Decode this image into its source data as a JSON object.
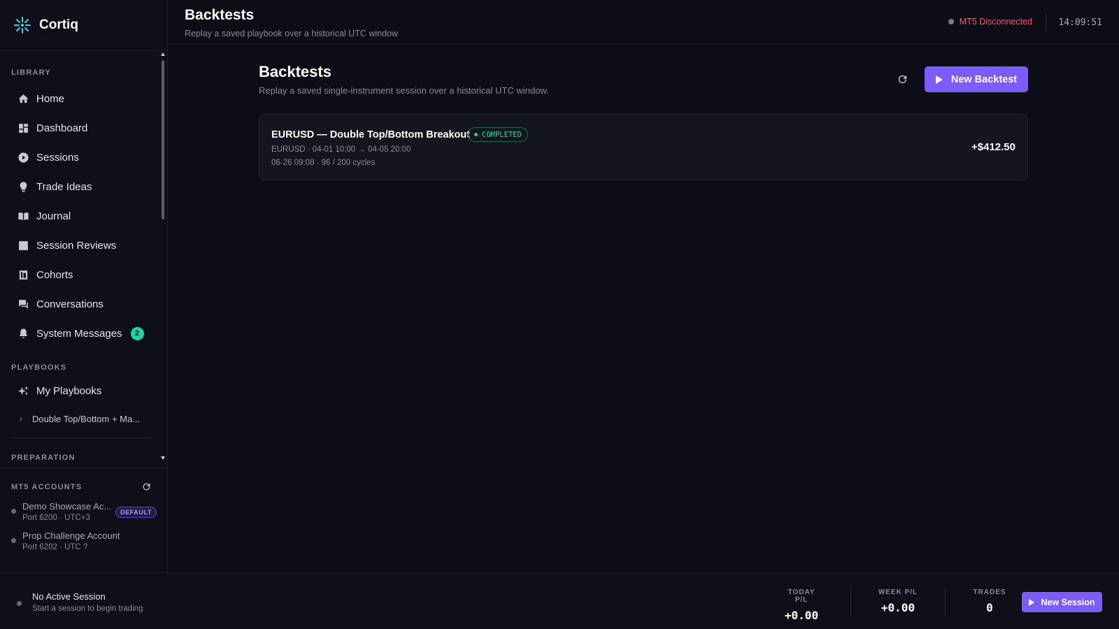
{
  "app": {
    "name": "Cortiq"
  },
  "sidebar": {
    "library_label": "LIBRARY",
    "items": [
      {
        "label": "Home",
        "icon": "home-icon"
      },
      {
        "label": "Dashboard",
        "icon": "dashboard-icon"
      },
      {
        "label": "Sessions",
        "icon": "play-circle-icon"
      },
      {
        "label": "Trade Ideas",
        "icon": "lightbulb-icon"
      },
      {
        "label": "Journal",
        "icon": "book-icon"
      },
      {
        "label": "Session Reviews",
        "icon": "review-icon"
      },
      {
        "label": "Cohorts",
        "icon": "cohorts-icon"
      },
      {
        "label": "Conversations",
        "icon": "chat-icon"
      },
      {
        "label": "System Messages",
        "icon": "bell-icon",
        "badge": "2"
      }
    ],
    "playbooks_label": "PLAYBOOKS",
    "my_playbooks": "My Playbooks",
    "playbook_item": "Double Top/Bottom + Ma...",
    "next_section_partial": "PREPARATION"
  },
  "accounts": {
    "label": "MT5 ACCOUNTS",
    "items": [
      {
        "name": "Demo Showcase Ac...",
        "meta": "Port 6200 · UTC+3",
        "badge": "DEFAULT"
      },
      {
        "name": "Prop Challenge Account",
        "meta": "Port 6202 · UTC ?"
      }
    ]
  },
  "topbar": {
    "title": "Backtests",
    "subtitle": "Replay a saved playbook over a historical UTC window",
    "status": "MT5 Disconnected",
    "clock": "14:09:51"
  },
  "main": {
    "title": "Backtests",
    "subtitle": "Replay a saved single-instrument session over a historical UTC window.",
    "new_backtest_label": "New Backtest",
    "backtests": [
      {
        "title": "EURUSD — Double Top/Bottom Breakout",
        "status": "COMPLETED",
        "meta1": "EURUSD · 04-01 10:00 → 04-05 20:00",
        "meta2": "06-26 09:08 · 96 / 200 cycles",
        "pnl": "+$412.50"
      }
    ]
  },
  "bottombar": {
    "session_title": "No Active Session",
    "session_sub": "Start a session to begin trading",
    "today_label": "TODAY P/L",
    "today_value": "+0.00",
    "week_label": "WEEK P/L",
    "week_value": "+0.00",
    "trades_label": "TRADES",
    "trades_value": "0",
    "new_session_label": "New Session"
  },
  "colors": {
    "accent": "#7c5cff",
    "success": "#1fd6a0",
    "danger": "#f05a6a",
    "background": "#0d0d17"
  }
}
